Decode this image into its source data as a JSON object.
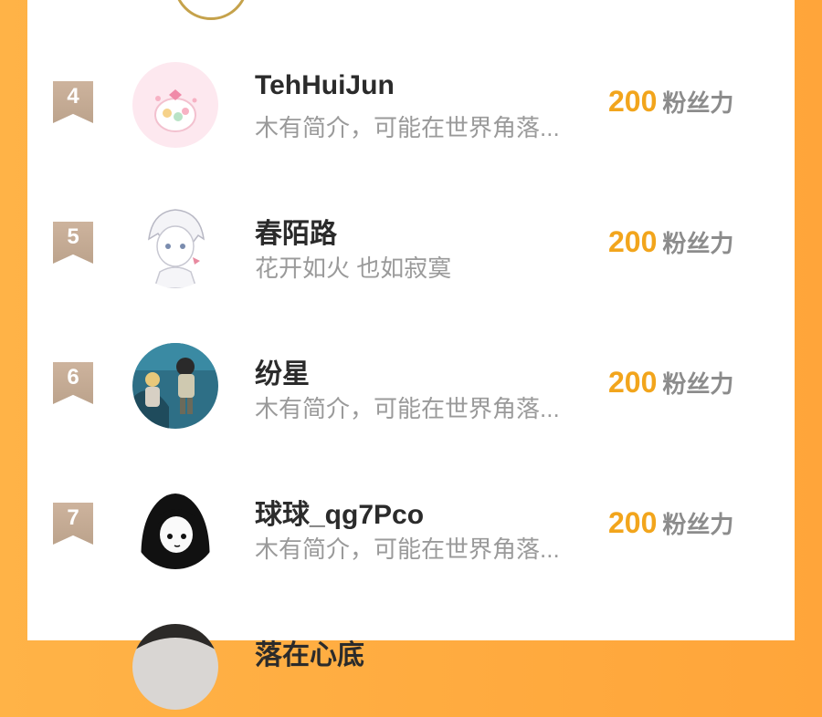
{
  "rows": [
    {
      "rank": "4",
      "name": "TehHuiJun",
      "bio": "木有简介，可能在世界角落...",
      "score": "200",
      "unit": "粉丝力"
    },
    {
      "rank": "5",
      "name": "春陌路",
      "bio": "花开如火 也如寂寞",
      "score": "200",
      "unit": "粉丝力"
    },
    {
      "rank": "6",
      "name": "纷星",
      "bio": "木有简介，可能在世界角落...",
      "score": "200",
      "unit": "粉丝力"
    },
    {
      "rank": "7",
      "name": "球球_qg7Pco",
      "bio": "木有简介，可能在世界角落...",
      "score": "200",
      "unit": "粉丝力"
    },
    {
      "rank": "",
      "name": "落在心底",
      "bio": "",
      "score": "",
      "unit": ""
    }
  ]
}
